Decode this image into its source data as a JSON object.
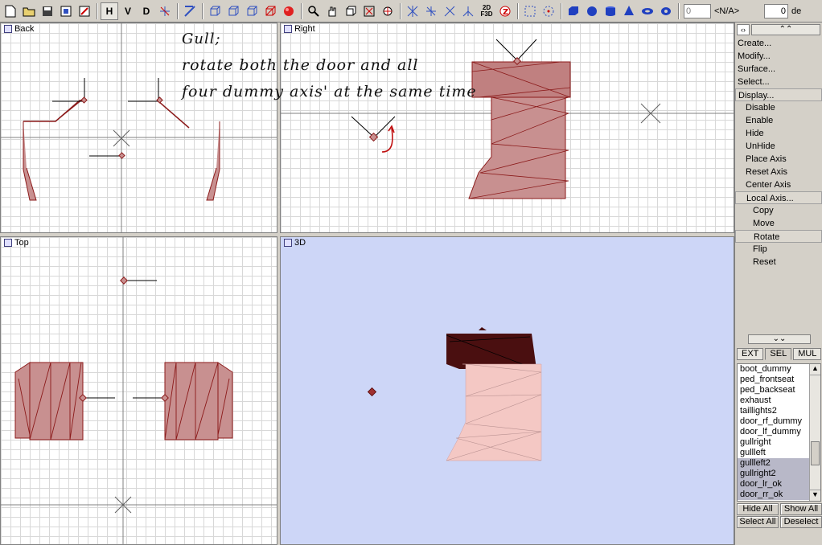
{
  "toolbar": {
    "view_buttons": [
      "H",
      "V",
      "D"
    ],
    "tex_2d3d": "2D\nF3D",
    "spin1_value": "0",
    "na_field": "<N/A>",
    "spin2_value": "0",
    "trailing_text": "de"
  },
  "viewports": {
    "back": {
      "label": "Back"
    },
    "right": {
      "label": "Right"
    },
    "top": {
      "label": "Top"
    },
    "3d": {
      "label": "3D"
    }
  },
  "annotation": {
    "line1": "Gull;",
    "line2": "rotate both the door and all",
    "line3": "four dummy axis' at the same time"
  },
  "panel": {
    "menu": [
      {
        "label": "Create...",
        "level": 0
      },
      {
        "label": "Modify...",
        "level": 0
      },
      {
        "label": "Surface...",
        "level": 0
      },
      {
        "label": "Select...",
        "level": 0
      },
      {
        "label": "Display...",
        "level": 0,
        "boxed": true
      },
      {
        "label": "Disable",
        "level": 1
      },
      {
        "label": "Enable",
        "level": 1
      },
      {
        "label": "Hide",
        "level": 1
      },
      {
        "label": "UnHide",
        "level": 1
      },
      {
        "label": "Place Axis",
        "level": 1
      },
      {
        "label": "Reset Axis",
        "level": 1
      },
      {
        "label": "Center Axis",
        "level": 1
      },
      {
        "label": "Local Axis...",
        "level": 1,
        "boxed": true
      },
      {
        "label": "Copy",
        "level": 2
      },
      {
        "label": "Move",
        "level": 2
      },
      {
        "label": "Rotate",
        "level": 2,
        "boxed": true
      },
      {
        "label": "Flip",
        "level": 2
      },
      {
        "label": "Reset",
        "level": 2
      }
    ],
    "tabs": [
      "EXT",
      "SEL",
      "MUL"
    ],
    "active_tab": "SEL",
    "list": [
      {
        "name": "boot_dummy",
        "selected": false
      },
      {
        "name": "ped_frontseat",
        "selected": false
      },
      {
        "name": "ped_backseat",
        "selected": false
      },
      {
        "name": "exhaust",
        "selected": false
      },
      {
        "name": "taillights2",
        "selected": false
      },
      {
        "name": "door_rf_dummy",
        "selected": false
      },
      {
        "name": "door_lf_dummy",
        "selected": false
      },
      {
        "name": "gullright",
        "selected": false
      },
      {
        "name": "gullleft",
        "selected": false
      },
      {
        "name": "gullleft2",
        "selected": true
      },
      {
        "name": "gullright2",
        "selected": true
      },
      {
        "name": "door_lr_ok",
        "selected": true
      },
      {
        "name": "door_rr_ok",
        "selected": true
      }
    ],
    "buttons": {
      "hide_all": "Hide All",
      "show_all": "Show All",
      "select_all": "Select All",
      "deselect": "Deselect"
    }
  },
  "colors": {
    "object_fill": "#c89090",
    "object_edge": "#8b1a1a",
    "viewport3d_bg": "#cdd6f7",
    "grid_line": "#d8d8d8"
  }
}
